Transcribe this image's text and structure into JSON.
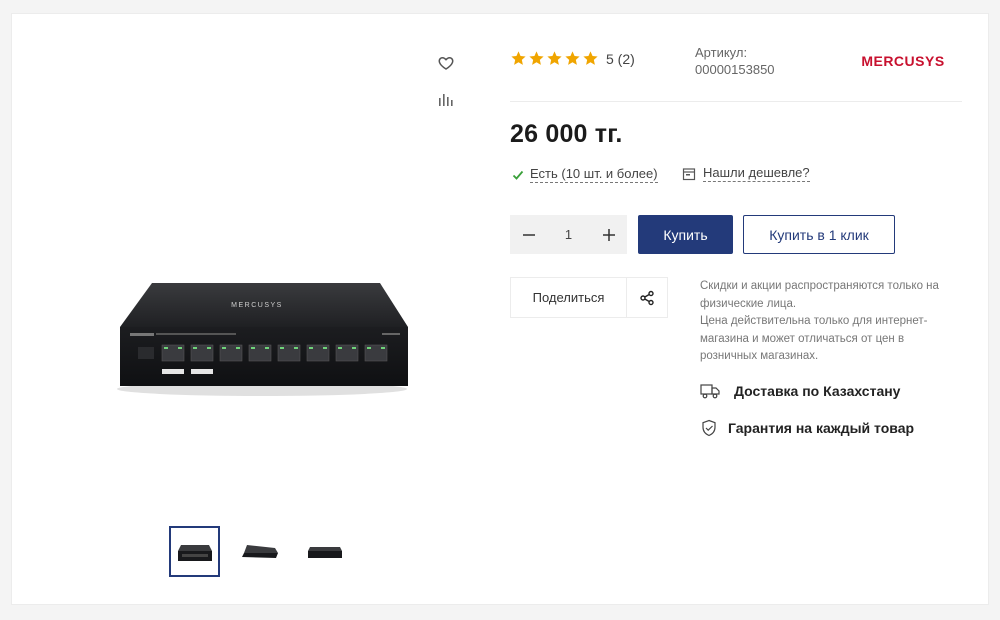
{
  "product": {
    "rating": {
      "stars": 5,
      "text": "5 (2)"
    },
    "sku": {
      "label": "Артикул:",
      "value": "00000153850"
    },
    "brand": "MERCUSYS",
    "price": "26 000 тг.",
    "stock_text": "Есть (10 шт. и более)",
    "cheaper_text": "Нашли дешевле?"
  },
  "purchase": {
    "quantity": "1",
    "buy_label": "Купить",
    "one_click_label": "Купить в 1 клик"
  },
  "share": {
    "label": "Поделиться"
  },
  "note": {
    "line1": "Скидки и акции распространяются только на физические лица.",
    "line2": "Цена действительна только для интернет-магазина и может отличаться от цен в розничных магазинах."
  },
  "features": {
    "delivery": "Доставка по Казахстану",
    "warranty": "Гарантия на каждый товар"
  },
  "colors": {
    "accent": "#233a7a",
    "star": "#f0a500",
    "check": "#3aa03a",
    "brand": "#c8102e"
  },
  "gallery": {
    "thumbnails": [
      "thumb-front",
      "thumb-angle",
      "thumb-side"
    ],
    "active_thumbnail": 1
  }
}
